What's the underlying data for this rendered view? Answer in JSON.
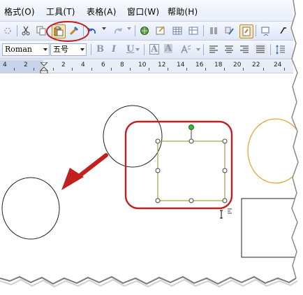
{
  "menubar": {
    "items": [
      {
        "label": "格式(O)"
      },
      {
        "label": "工具(T)"
      },
      {
        "label": "表格(A)"
      },
      {
        "label": "窗口(W)"
      },
      {
        "label": "帮助(H)"
      }
    ]
  },
  "toolbar_standard": {
    "icons": [
      "cut-icon",
      "copy-icon",
      "paste-icon",
      "format-painter-icon",
      "undo-icon",
      "redo-icon",
      "hyperlink-icon",
      "tables-borders-icon",
      "insert-table-icon",
      "insert-excel-icon",
      "columns-icon",
      "drawing-icon",
      "document-map-icon",
      "show-formatting-icon"
    ],
    "highlighted": [
      "paste-icon",
      "format-painter-icon"
    ]
  },
  "toolbar_formatting": {
    "font_name": "Roman",
    "font_size": "五号",
    "bold_label": "B",
    "italic_label": "I",
    "underline_label": "U",
    "char_border_label": "A",
    "char_shading_label": "A",
    "char_scale_label": "A"
  },
  "ruler": {
    "numbers": [
      "4",
      "2",
      "2",
      "4",
      "6",
      "8",
      "10",
      "12",
      "14",
      "16",
      "18",
      "20",
      "22",
      "24"
    ]
  },
  "colors": {
    "highlight_red": "#c21f1f",
    "selection_box": "#9da43a",
    "rotate_handle": "#3db33d",
    "orange_circle": "#e2a63d"
  }
}
